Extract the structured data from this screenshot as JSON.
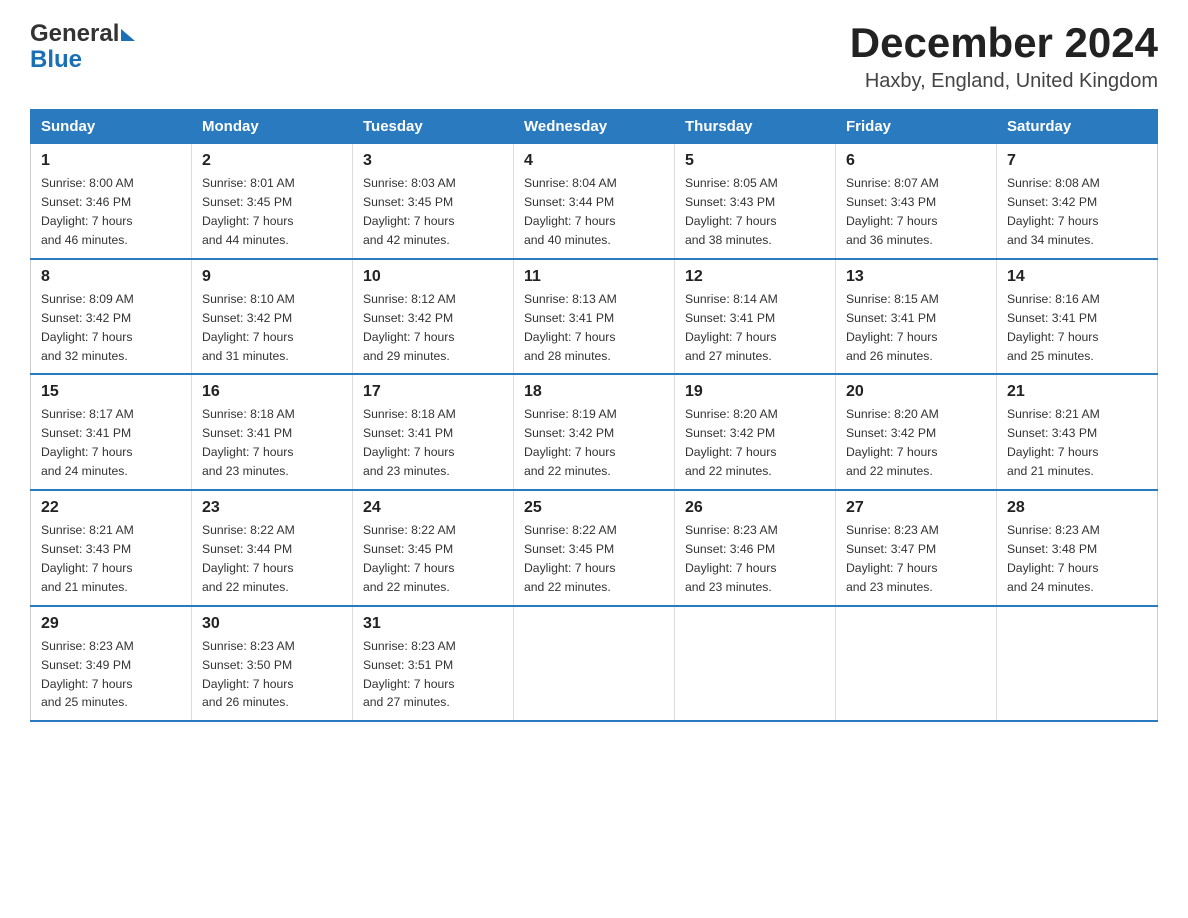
{
  "header": {
    "logo_general": "General",
    "logo_blue": "Blue",
    "month_year": "December 2024",
    "location": "Haxby, England, United Kingdom"
  },
  "days_of_week": [
    "Sunday",
    "Monday",
    "Tuesday",
    "Wednesday",
    "Thursday",
    "Friday",
    "Saturday"
  ],
  "weeks": [
    [
      {
        "day": "1",
        "sunrise": "8:00 AM",
        "sunset": "3:46 PM",
        "daylight": "7 hours and 46 minutes."
      },
      {
        "day": "2",
        "sunrise": "8:01 AM",
        "sunset": "3:45 PM",
        "daylight": "7 hours and 44 minutes."
      },
      {
        "day": "3",
        "sunrise": "8:03 AM",
        "sunset": "3:45 PM",
        "daylight": "7 hours and 42 minutes."
      },
      {
        "day": "4",
        "sunrise": "8:04 AM",
        "sunset": "3:44 PM",
        "daylight": "7 hours and 40 minutes."
      },
      {
        "day": "5",
        "sunrise": "8:05 AM",
        "sunset": "3:43 PM",
        "daylight": "7 hours and 38 minutes."
      },
      {
        "day": "6",
        "sunrise": "8:07 AM",
        "sunset": "3:43 PM",
        "daylight": "7 hours and 36 minutes."
      },
      {
        "day": "7",
        "sunrise": "8:08 AM",
        "sunset": "3:42 PM",
        "daylight": "7 hours and 34 minutes."
      }
    ],
    [
      {
        "day": "8",
        "sunrise": "8:09 AM",
        "sunset": "3:42 PM",
        "daylight": "7 hours and 32 minutes."
      },
      {
        "day": "9",
        "sunrise": "8:10 AM",
        "sunset": "3:42 PM",
        "daylight": "7 hours and 31 minutes."
      },
      {
        "day": "10",
        "sunrise": "8:12 AM",
        "sunset": "3:42 PM",
        "daylight": "7 hours and 29 minutes."
      },
      {
        "day": "11",
        "sunrise": "8:13 AM",
        "sunset": "3:41 PM",
        "daylight": "7 hours and 28 minutes."
      },
      {
        "day": "12",
        "sunrise": "8:14 AM",
        "sunset": "3:41 PM",
        "daylight": "7 hours and 27 minutes."
      },
      {
        "day": "13",
        "sunrise": "8:15 AM",
        "sunset": "3:41 PM",
        "daylight": "7 hours and 26 minutes."
      },
      {
        "day": "14",
        "sunrise": "8:16 AM",
        "sunset": "3:41 PM",
        "daylight": "7 hours and 25 minutes."
      }
    ],
    [
      {
        "day": "15",
        "sunrise": "8:17 AM",
        "sunset": "3:41 PM",
        "daylight": "7 hours and 24 minutes."
      },
      {
        "day": "16",
        "sunrise": "8:18 AM",
        "sunset": "3:41 PM",
        "daylight": "7 hours and 23 minutes."
      },
      {
        "day": "17",
        "sunrise": "8:18 AM",
        "sunset": "3:41 PM",
        "daylight": "7 hours and 23 minutes."
      },
      {
        "day": "18",
        "sunrise": "8:19 AM",
        "sunset": "3:42 PM",
        "daylight": "7 hours and 22 minutes."
      },
      {
        "day": "19",
        "sunrise": "8:20 AM",
        "sunset": "3:42 PM",
        "daylight": "7 hours and 22 minutes."
      },
      {
        "day": "20",
        "sunrise": "8:20 AM",
        "sunset": "3:42 PM",
        "daylight": "7 hours and 22 minutes."
      },
      {
        "day": "21",
        "sunrise": "8:21 AM",
        "sunset": "3:43 PM",
        "daylight": "7 hours and 21 minutes."
      }
    ],
    [
      {
        "day": "22",
        "sunrise": "8:21 AM",
        "sunset": "3:43 PM",
        "daylight": "7 hours and 21 minutes."
      },
      {
        "day": "23",
        "sunrise": "8:22 AM",
        "sunset": "3:44 PM",
        "daylight": "7 hours and 22 minutes."
      },
      {
        "day": "24",
        "sunrise": "8:22 AM",
        "sunset": "3:45 PM",
        "daylight": "7 hours and 22 minutes."
      },
      {
        "day": "25",
        "sunrise": "8:22 AM",
        "sunset": "3:45 PM",
        "daylight": "7 hours and 22 minutes."
      },
      {
        "day": "26",
        "sunrise": "8:23 AM",
        "sunset": "3:46 PM",
        "daylight": "7 hours and 23 minutes."
      },
      {
        "day": "27",
        "sunrise": "8:23 AM",
        "sunset": "3:47 PM",
        "daylight": "7 hours and 23 minutes."
      },
      {
        "day": "28",
        "sunrise": "8:23 AM",
        "sunset": "3:48 PM",
        "daylight": "7 hours and 24 minutes."
      }
    ],
    [
      {
        "day": "29",
        "sunrise": "8:23 AM",
        "sunset": "3:49 PM",
        "daylight": "7 hours and 25 minutes."
      },
      {
        "day": "30",
        "sunrise": "8:23 AM",
        "sunset": "3:50 PM",
        "daylight": "7 hours and 26 minutes."
      },
      {
        "day": "31",
        "sunrise": "8:23 AM",
        "sunset": "3:51 PM",
        "daylight": "7 hours and 27 minutes."
      },
      null,
      null,
      null,
      null
    ]
  ],
  "labels": {
    "sunrise": "Sunrise:",
    "sunset": "Sunset:",
    "daylight": "Daylight:"
  }
}
